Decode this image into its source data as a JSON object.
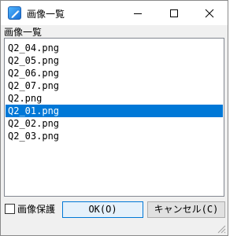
{
  "window": {
    "title": "画像一覧",
    "icon": "pencil-app-icon"
  },
  "titlebar_buttons": {
    "minimize": "minimize-icon",
    "maximize": "maximize-icon",
    "close": "close-icon"
  },
  "section_label": "画像一覧",
  "list": {
    "items": [
      "Q2_04.png",
      "Q2_05.png",
      "Q2_06.png",
      "Q2_07.png",
      "Q2.png",
      "Q2_01.png",
      "Q2_02.png",
      "Q2_03.png"
    ],
    "selected": "Q2_01.png"
  },
  "footer": {
    "checkbox_label": "画像保護",
    "checkbox_checked": false,
    "ok_label": "OK(O)",
    "cancel_label": "キャンセル(C)"
  },
  "colors": {
    "selection": "#0078d7",
    "ok_border": "#0078d7",
    "window_bg": "#f0f0f0"
  }
}
